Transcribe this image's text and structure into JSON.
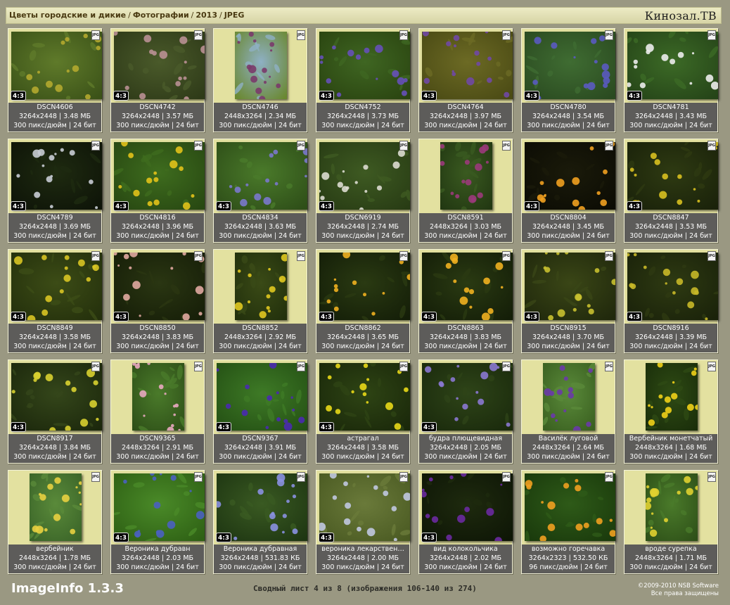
{
  "breadcrumb": [
    "Цветы городские и дикие",
    "Фотографии",
    "2013",
    "JPEG"
  ],
  "brand": "Кинозал.ТВ",
  "images": [
    {
      "name": "DSCN4606",
      "size": "3264x2448 | 3.48 МБ",
      "meta": "300 пикс/дюйм | 24 бит",
      "ratio": "4:3",
      "orient": "land",
      "palette": "#5f7a2a,#3b5218,#b2a92f"
    },
    {
      "name": "DSCN4742",
      "size": "3264x2448 | 3.57 МБ",
      "meta": "300 пикс/дюйм | 24 бит",
      "ratio": "4:3",
      "orient": "land",
      "palette": "#4a5a2a,#2e3a18,#b99094"
    },
    {
      "name": "DSCN4746",
      "size": "2448x3264 | 2.34 МБ",
      "meta": "300 пикс/дюйм | 24 бит",
      "ratio": "",
      "orient": "port",
      "palette": "#8eb0c4,#6a8830,#7a3a6a"
    },
    {
      "name": "DSCN4752",
      "size": "3264x2448 | 3.73 МБ",
      "meta": "300 пикс/дюйм | 24 бит",
      "ratio": "4:3",
      "orient": "land",
      "palette": "#3f6622,#2a4410,#6650b8"
    },
    {
      "name": "DSCN4764",
      "size": "3264x2448 | 3.97 МБ",
      "meta": "300 пикс/дюйм | 24 бит",
      "ratio": "4:3",
      "orient": "land",
      "palette": "#6c6a24,#4a4a14,#7048a4"
    },
    {
      "name": "DSCN4780",
      "size": "3264x2448 | 3.54 МБ",
      "meta": "300 пикс/дюйм | 24 бит",
      "ratio": "4:3",
      "orient": "land",
      "palette": "#3f6c32,#2a4a20,#5a5ac0"
    },
    {
      "name": "DSCN4781",
      "size": "3264x2448 | 3.43 МБ",
      "meta": "300 пикс/дюйм | 24 бит",
      "ratio": "4:3",
      "orient": "land",
      "palette": "#3c6a26,#254418,#ececec"
    },
    {
      "name": "DSCN4789",
      "size": "3264x2448 | 3.69 МБ",
      "meta": "300 пикс/дюйм | 24 бит",
      "ratio": "4:3",
      "orient": "land",
      "palette": "#1e2a10,#0e1408,#c8ccd4"
    },
    {
      "name": "DSCN4816",
      "size": "3264x2448 | 3.96 МБ",
      "meta": "300 пикс/дюйм | 24 бит",
      "ratio": "4:3",
      "orient": "land",
      "palette": "#3e6c1e,#284812,#e2c21a"
    },
    {
      "name": "DSCN4834",
      "size": "3264x2448 | 3.63 МБ",
      "meta": "300 пикс/дюйм | 24 бит",
      "ratio": "4:3",
      "orient": "land",
      "palette": "#4a7a2a,#2e4e18,#7a78cc"
    },
    {
      "name": "DSCN6919",
      "size": "3264x2448 | 2.74 МБ",
      "meta": "300 пикс/дюйм | 24 бит",
      "ratio": "4:3",
      "orient": "land",
      "palette": "#3e5a22,#283c14,#dcdcd0"
    },
    {
      "name": "DSCN8591",
      "size": "2448x3264 | 3.03 МБ",
      "meta": "300 пикс/дюйм | 24 бит",
      "ratio": "",
      "orient": "port",
      "palette": "#3a5a20,#223812,#9a3a7a"
    },
    {
      "name": "DSCN8804",
      "size": "3264x2448 | 3.45 МБ",
      "meta": "300 пикс/дюйм | 24 бит",
      "ratio": "4:3",
      "orient": "land",
      "palette": "#1a1a0a,#0c0c04,#f0a020"
    },
    {
      "name": "DSCN8847",
      "size": "3264x2448 | 3.53 МБ",
      "meta": "300 пикс/дюйм | 24 бит",
      "ratio": "4:3",
      "orient": "land",
      "palette": "#2e3a12,#1a220a,#d8c020"
    },
    {
      "name": "DSCN8849",
      "size": "3264x2448 | 3.58 МБ",
      "meta": "300 пикс/дюйм | 24 бит",
      "ratio": "4:3",
      "orient": "land",
      "palette": "#3c4c16,#24300c,#d8c424"
    },
    {
      "name": "DSCN8850",
      "size": "3264x2448 | 3.83 МБ",
      "meta": "300 пикс/дюйм | 24 бит",
      "ratio": "4:3",
      "orient": "land",
      "palette": "#2a3612,#161e08,#e0a8a0"
    },
    {
      "name": "DSCN8852",
      "size": "2448x3264 | 2.92 МБ",
      "meta": "300 пикс/дюйм | 24 бит",
      "ratio": "",
      "orient": "port",
      "palette": "#3a4a16,#22300c,#e0c820"
    },
    {
      "name": "DSCN8862",
      "size": "3264x2448 | 3.65 МБ",
      "meta": "300 пикс/дюйм | 24 бит",
      "ratio": "4:3",
      "orient": "land",
      "palette": "#2a3a12,#141e08,#f0b020"
    },
    {
      "name": "DSCN8863",
      "size": "3264x2448 | 3.83 МБ",
      "meta": "300 пикс/дюйм | 24 бит",
      "ratio": "4:3",
      "orient": "land",
      "palette": "#2a3a12,#141e08,#f0b020"
    },
    {
      "name": "DSCN8915",
      "size": "3264x2448 | 3.70 МБ",
      "meta": "300 пикс/дюйм | 24 бит",
      "ratio": "4:3",
      "orient": "land",
      "palette": "#3a4616,#20280c,#c8c030"
    },
    {
      "name": "DSCN8916",
      "size": "3264x2448 | 3.39 МБ",
      "meta": "300 пикс/дюйм | 24 бит",
      "ratio": "4:3",
      "orient": "land",
      "palette": "#2e3a12,#1a220a,#c8b828"
    },
    {
      "name": "DSCN8917",
      "size": "3264x2448 | 3.84 МБ",
      "meta": "300 пикс/дюйм | 24 бит",
      "ratio": "4:3",
      "orient": "land",
      "palette": "#34461a,#1c280c,#d8d030"
    },
    {
      "name": "DSCN9365",
      "size": "2448x3264 | 2.91 МБ",
      "meta": "300 пикс/дюйм | 24 бит",
      "ratio": "",
      "orient": "port",
      "palette": "#4a7a2a,#2e5018,#e8a8c0"
    },
    {
      "name": "DSCN9367",
      "size": "3264x2448 | 3.91 МБ",
      "meta": "300 пикс/дюйм | 24 бит",
      "ratio": "4:3",
      "orient": "land",
      "palette": "#3e7a26,#245014,#4a2ab0"
    },
    {
      "name": "астрагал",
      "size": "3264x2448 | 3.58 МБ",
      "meta": "300 пикс/дюйм | 24 бит",
      "ratio": "4:3",
      "orient": "land",
      "palette": "#2e4414,#1a280a,#e8d818"
    },
    {
      "name": "будра плющевидная",
      "size": "3264x2448 | 2.05 МБ",
      "meta": "300 пикс/дюйм | 24 бит",
      "ratio": "4:3",
      "orient": "land",
      "palette": "#2e4418,#1a2a0c,#8a78d0"
    },
    {
      "name": "Василёк луговой",
      "size": "2448x3264 | 2.64 МБ",
      "meta": "300 пикс/дюйм | 24 бит",
      "ratio": "",
      "orient": "port",
      "palette": "#5a8a3a,#3a6020,#6a3aa8"
    },
    {
      "name": "Вербейник монетчатый",
      "size": "2448x3264 | 1.68 МБ",
      "meta": "300 пикс/дюйм | 24 бит",
      "ratio": "",
      "orient": "port",
      "palette": "#2e4a14,#1a2e0a,#f0d018"
    },
    {
      "name": "вербейник",
      "size": "2448x3264 | 1.78 МБ",
      "meta": "300 пикс/дюйм | 24 бит",
      "ratio": "",
      "orient": "port",
      "palette": "#5a8a3a,#3a6428,#e8d040"
    },
    {
      "name": "Вероника дубравн",
      "size": "3264x2448 | 2.03 МБ",
      "meta": "300 пикс/дюйм | 24 бит",
      "ratio": "4:3",
      "orient": "land",
      "palette": "#4a8a28,#2e6014,#4a60c0"
    },
    {
      "name": "Вероника дубравная",
      "size": "3264x2448 | 531.83 КБ",
      "meta": "300 пикс/дюйм | 24 бит",
      "ratio": "4:3",
      "orient": "land",
      "palette": "#3a5a22,#1e3612,#8a90e0"
    },
    {
      "name": "вероника лекарствен…",
      "size": "3264x2448 | 2.00 МБ",
      "meta": "300 пикс/дюйм | 24 бит",
      "ratio": "4:3",
      "orient": "land",
      "palette": "#6a7a3a,#4a5a22,#c0c8e0"
    },
    {
      "name": "вид колокольчика",
      "size": "3264x2448 | 2.02 МБ",
      "meta": "300 пикс/дюйм | 24 бит",
      "ratio": "4:3",
      "orient": "land",
      "palette": "#1e2a0e,#0e1606,#6a2aa0"
    },
    {
      "name": "возможно горечавка",
      "size": "3264x2323 | 532.50 КБ",
      "meta": "96 пикс/дюйм | 24 бит",
      "ratio": "",
      "orient": "land",
      "palette": "#2e5a18,#1a3a0c,#f0a020"
    },
    {
      "name": "вроде сурепка",
      "size": "2448x3264 | 1.71 МБ",
      "meta": "300 пикс/дюйм | 24 бит",
      "ratio": "",
      "orient": "port",
      "palette": "#4a7a2a,#2e5018,#e0d030"
    }
  ],
  "footer": {
    "app": "ImageInfo 1.3.3",
    "summary": "Сводный лист 4 из 8 (изображения 106-140 из 274)",
    "copyright": "©2009-2010 NSB Software",
    "rights": "Все права защищены"
  },
  "jpg_badge": "JPG"
}
